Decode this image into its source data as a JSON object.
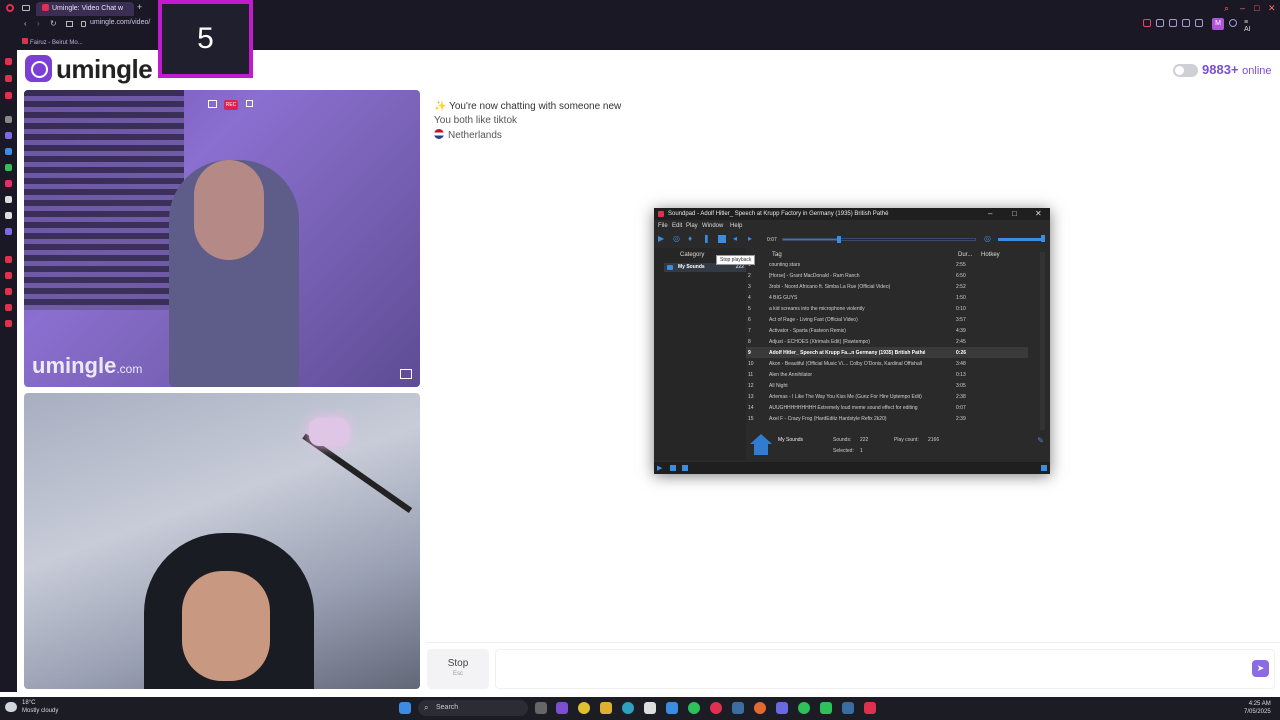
{
  "browser": {
    "tab_title": "Umingle: Video Chat w",
    "address": "umingle.com/video/",
    "bookmark": "Fairuz - Beirut Mo..."
  },
  "overlay": {
    "countdown": "5"
  },
  "site": {
    "logo_text": "umingle",
    "online_count": "9883",
    "online_plus": "+",
    "online_label": "online"
  },
  "video": {
    "watermark_main": "umingle",
    "watermark_tld": ".com",
    "rec_badge": "REC"
  },
  "chat": {
    "messages": [
      {
        "icon": "✨",
        "text": "You're now chatting with someone new"
      },
      {
        "text": "You both like tiktok"
      },
      {
        "text": "Netherlands"
      }
    ],
    "stop_label": "Stop",
    "stop_hint": "Esc",
    "send_icon": "send-icon"
  },
  "soundpad": {
    "title": "Soundpad - Adolf Hitler_ Speech at Krupp Factory in Germany (1935)  British Pathé",
    "menu": [
      "File",
      "Edit",
      "Play",
      "Window",
      "Help"
    ],
    "time": "0:07",
    "progress_fraction": 0.29,
    "tooltip": "Stop playback",
    "columns": {
      "category": "Category",
      "tag": "Tag",
      "duration": "Dur...",
      "hotkey": "Hotkey"
    },
    "category": {
      "name": "My Sounds",
      "count": "222"
    },
    "rows": [
      {
        "n": "1",
        "title": "counting stars",
        "dur": "2:55"
      },
      {
        "n": "2",
        "title": "[Horse] - Grant MacDonald - Ram Ranch",
        "dur": "6:50"
      },
      {
        "n": "3",
        "title": "3robi - Noord Africano ft. Simba La Rue (Official Video)",
        "dur": "2:52"
      },
      {
        "n": "4",
        "title": "4 BIG GUYS",
        "dur": "1:50"
      },
      {
        "n": "5",
        "title": "a kid screams into the microphone violently",
        "dur": "0:10"
      },
      {
        "n": "6",
        "title": "Act of Rage - Living Fast (Official Video)",
        "dur": "3:57"
      },
      {
        "n": "7",
        "title": "Activator - Sparta (Fasteon Remix)",
        "dur": "4:39"
      },
      {
        "n": "8",
        "title": "Adjust - ECHOES (Xtrimals Edit) (Rawtempo)",
        "dur": "2:45"
      },
      {
        "n": "9",
        "title": "Adolf Hitler_ Speech at Krupp Fa...n Germany (1935)  British Pathé",
        "dur": "0:26",
        "selected": true
      },
      {
        "n": "10",
        "title": "Akon - Beautiful (Official Music Vi.... Colby O'Donis, Kardinal Offishall",
        "dur": "3:48"
      },
      {
        "n": "11",
        "title": "Alen the Annihilator",
        "dur": "0:13"
      },
      {
        "n": "12",
        "title": "All Night",
        "dur": "3:05"
      },
      {
        "n": "13",
        "title": "Artemas - I Like The Way You Kiss Me (Gunz For Hire Uptempo Edit)",
        "dur": "2:38"
      },
      {
        "n": "14",
        "title": "AUUGHHHHHHHHH Extremely loud meme sound effect for editing",
        "dur": "0:07"
      },
      {
        "n": "15",
        "title": "Axel F - Crazy Frog (HardEditz Hardstyle Refix 2k20)",
        "dur": "2:39"
      }
    ],
    "footer": {
      "name": "My Sounds",
      "sounds_label": "Sounds:",
      "sounds_value": "222",
      "playcount_label": "Play count:",
      "playcount_value": "2166",
      "selected_label": "Selected:",
      "selected_value": "1"
    }
  },
  "taskbar": {
    "weather_temp": "18°C",
    "weather_desc": "Mostly cloudy",
    "search_placeholder": "Search",
    "time": "4:25 AM",
    "date": "7/05/2025"
  }
}
